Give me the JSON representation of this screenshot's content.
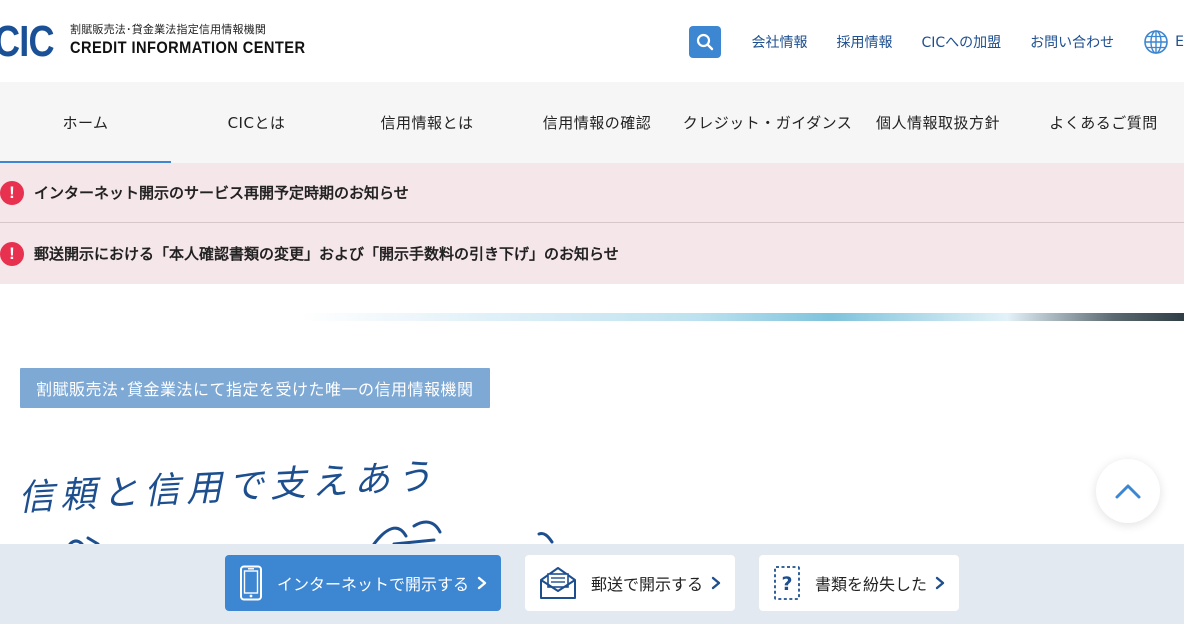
{
  "header": {
    "logo_mark": "CIC",
    "logo_sub": "割賦販売法･貸金業法指定信用情報機関",
    "logo_en": "CREDIT INFORMATION CENTER",
    "util_links": [
      "会社情報",
      "採用情報",
      "CICへの加盟",
      "お問い合わせ"
    ],
    "lang_label": "E"
  },
  "gnav": {
    "items": [
      "ホーム",
      "CICとは",
      "信用情報とは",
      "信用情報の確認",
      "クレジット・ガイダンス",
      "個人情報取扱方針",
      "よくあるご質問"
    ],
    "active_index": 0
  },
  "notices": [
    {
      "icon": "!",
      "text": "インターネット開示のサービス再開予定時期のお知らせ"
    },
    {
      "icon": "!",
      "text": "郵送開示における「本人確認書類の変更」および「開示手数料の引き下げ」のお知らせ"
    }
  ],
  "hero": {
    "badge": "割賦販売法･貸金業法にて指定を受けた唯一の信用情報機関",
    "handwritten": "信頼と信用で支えあう"
  },
  "bottom_bar": {
    "internet_label": "インターネットで開示する",
    "mail_label": "郵送で開示する",
    "lost_label": "書類を紛失した"
  },
  "colors": {
    "brand": "#1a5096",
    "accent": "#3d86d1",
    "alert": "#e8304f",
    "notice_bg": "#f5e6e9",
    "badge_bg": "#7ea9d5",
    "bottom_bg": "#e2e9f1"
  }
}
